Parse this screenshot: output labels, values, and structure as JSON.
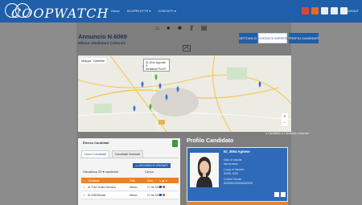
{
  "header": {
    "logo_text": "COOPWATCH",
    "nav_items": [
      "Home",
      "SCOPRI ETTS ▾",
      "CONTATTI ▾"
    ],
    "logout_label": "LOGOUT",
    "social_icons": [
      "red-square-icon",
      "orange-square-icon",
      "facebook-icon",
      "linkedin-icon",
      "instagram-icon"
    ]
  },
  "toolbar": {
    "icons": [
      "home-icon",
      "chat-icon",
      "group-icon",
      "key-icon",
      "document-icon"
    ]
  },
  "announcement": {
    "title": "Annuncio N.6069",
    "subtitle": "Milano: Mediatore Culturale"
  },
  "buttons": {
    "dettaglio": "DETTAGLIO",
    "scheda_impresa": "SCHEDA DI IMPRESA",
    "profili_candidati": "PROFILI CANDIDATI"
  },
  "map": {
    "tab_map": "Mappa",
    "tab_satellite": "Satellite",
    "popup_line1": "ID-2044 Agenzie S.",
    "popup_line2": "Mediatore Pro/Pr",
    "zoom_in": "+",
    "zoom_out": "−",
    "legend": "● Candidato   ● Candidato Visionato"
  },
  "candidates_panel": {
    "title": "Elenco Candidati",
    "tabs": [
      "Nuovi Candidati",
      "Candidati Visionati"
    ],
    "go_button": "◂ ▸ AGGIUNGI AI VISIONATI",
    "show_label": "Visualizza 25  ▾  candidati",
    "search_label": "Cerca",
    "columns": [
      "☐",
      "Candidato",
      "Città",
      "Data",
      "icons"
    ],
    "rows": [
      {
        "candidate": "ID-7164 Scalisi Veronica",
        "city": "Milano",
        "date": "17-06-2019"
      },
      {
        "candidate": "ID-2058 Beraldi",
        "city": "Milano",
        "date": "17-06-2019"
      }
    ]
  },
  "profile": {
    "section_title": "Profilo Candidato",
    "name": "ID_3054 Agnese",
    "label_birth": "Data di nascita",
    "value_birth": "xxx-xx-xxxx",
    "label_place": "Luogo di Nascita",
    "value_place": "XXXX, XXX",
    "label_code": "Codice Fiscale",
    "value_code": "XXXXXXXXXXXXXXXX"
  },
  "colors": {
    "primary": "#1f5ea8",
    "accent": "#e4832b",
    "background": "#8c8c8c"
  }
}
